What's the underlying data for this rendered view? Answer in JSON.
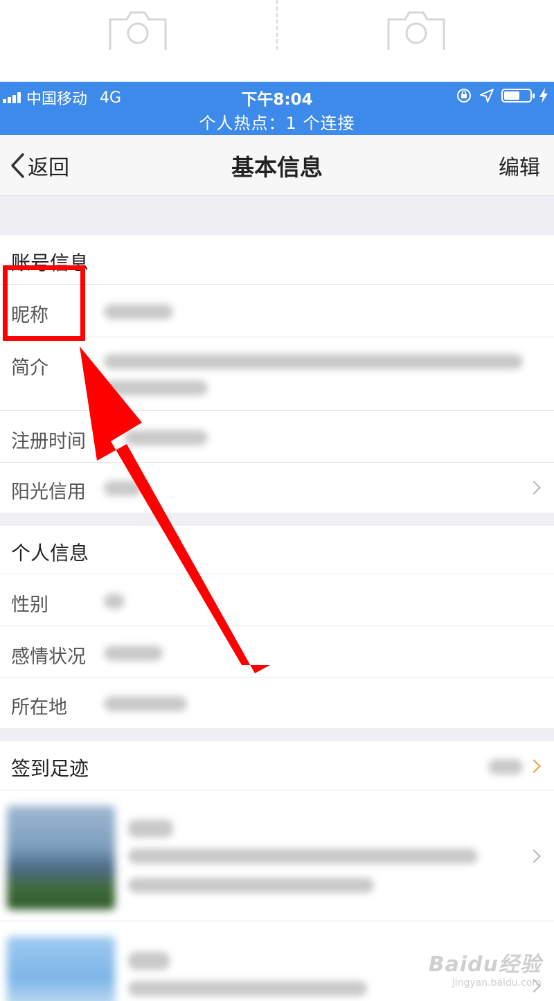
{
  "status_bar": {
    "carrier": "中国移动",
    "network": "4G",
    "time": "下午8:04",
    "hotspot": "个人热点：1 个连接"
  },
  "nav": {
    "back_label": "返回",
    "title": "基本信息",
    "edit_label": "编辑"
  },
  "account_section": {
    "header": "账号信息",
    "rows": [
      {
        "label": "昵称"
      },
      {
        "label": "简介"
      },
      {
        "label": "注册时间"
      },
      {
        "label": "阳光信用"
      }
    ]
  },
  "personal_section": {
    "header": "个人信息",
    "rows": [
      {
        "label": "性别"
      },
      {
        "label": "感情状况"
      },
      {
        "label": "所在地"
      }
    ]
  },
  "checkin_section": {
    "header": "签到足迹"
  },
  "watermark": {
    "main": "Baidu经验",
    "sub": "jingyan.baidu.com"
  },
  "colors": {
    "status_bar": "#3d8aea",
    "annotation": "#ff0000",
    "accent_orange": "#f19a3a"
  },
  "icons": [
    "camera-icon",
    "signal-icon",
    "lock-rotation-icon",
    "location-icon",
    "battery-icon",
    "charging-icon",
    "back-chevron-icon",
    "chevron-right-icon"
  ]
}
